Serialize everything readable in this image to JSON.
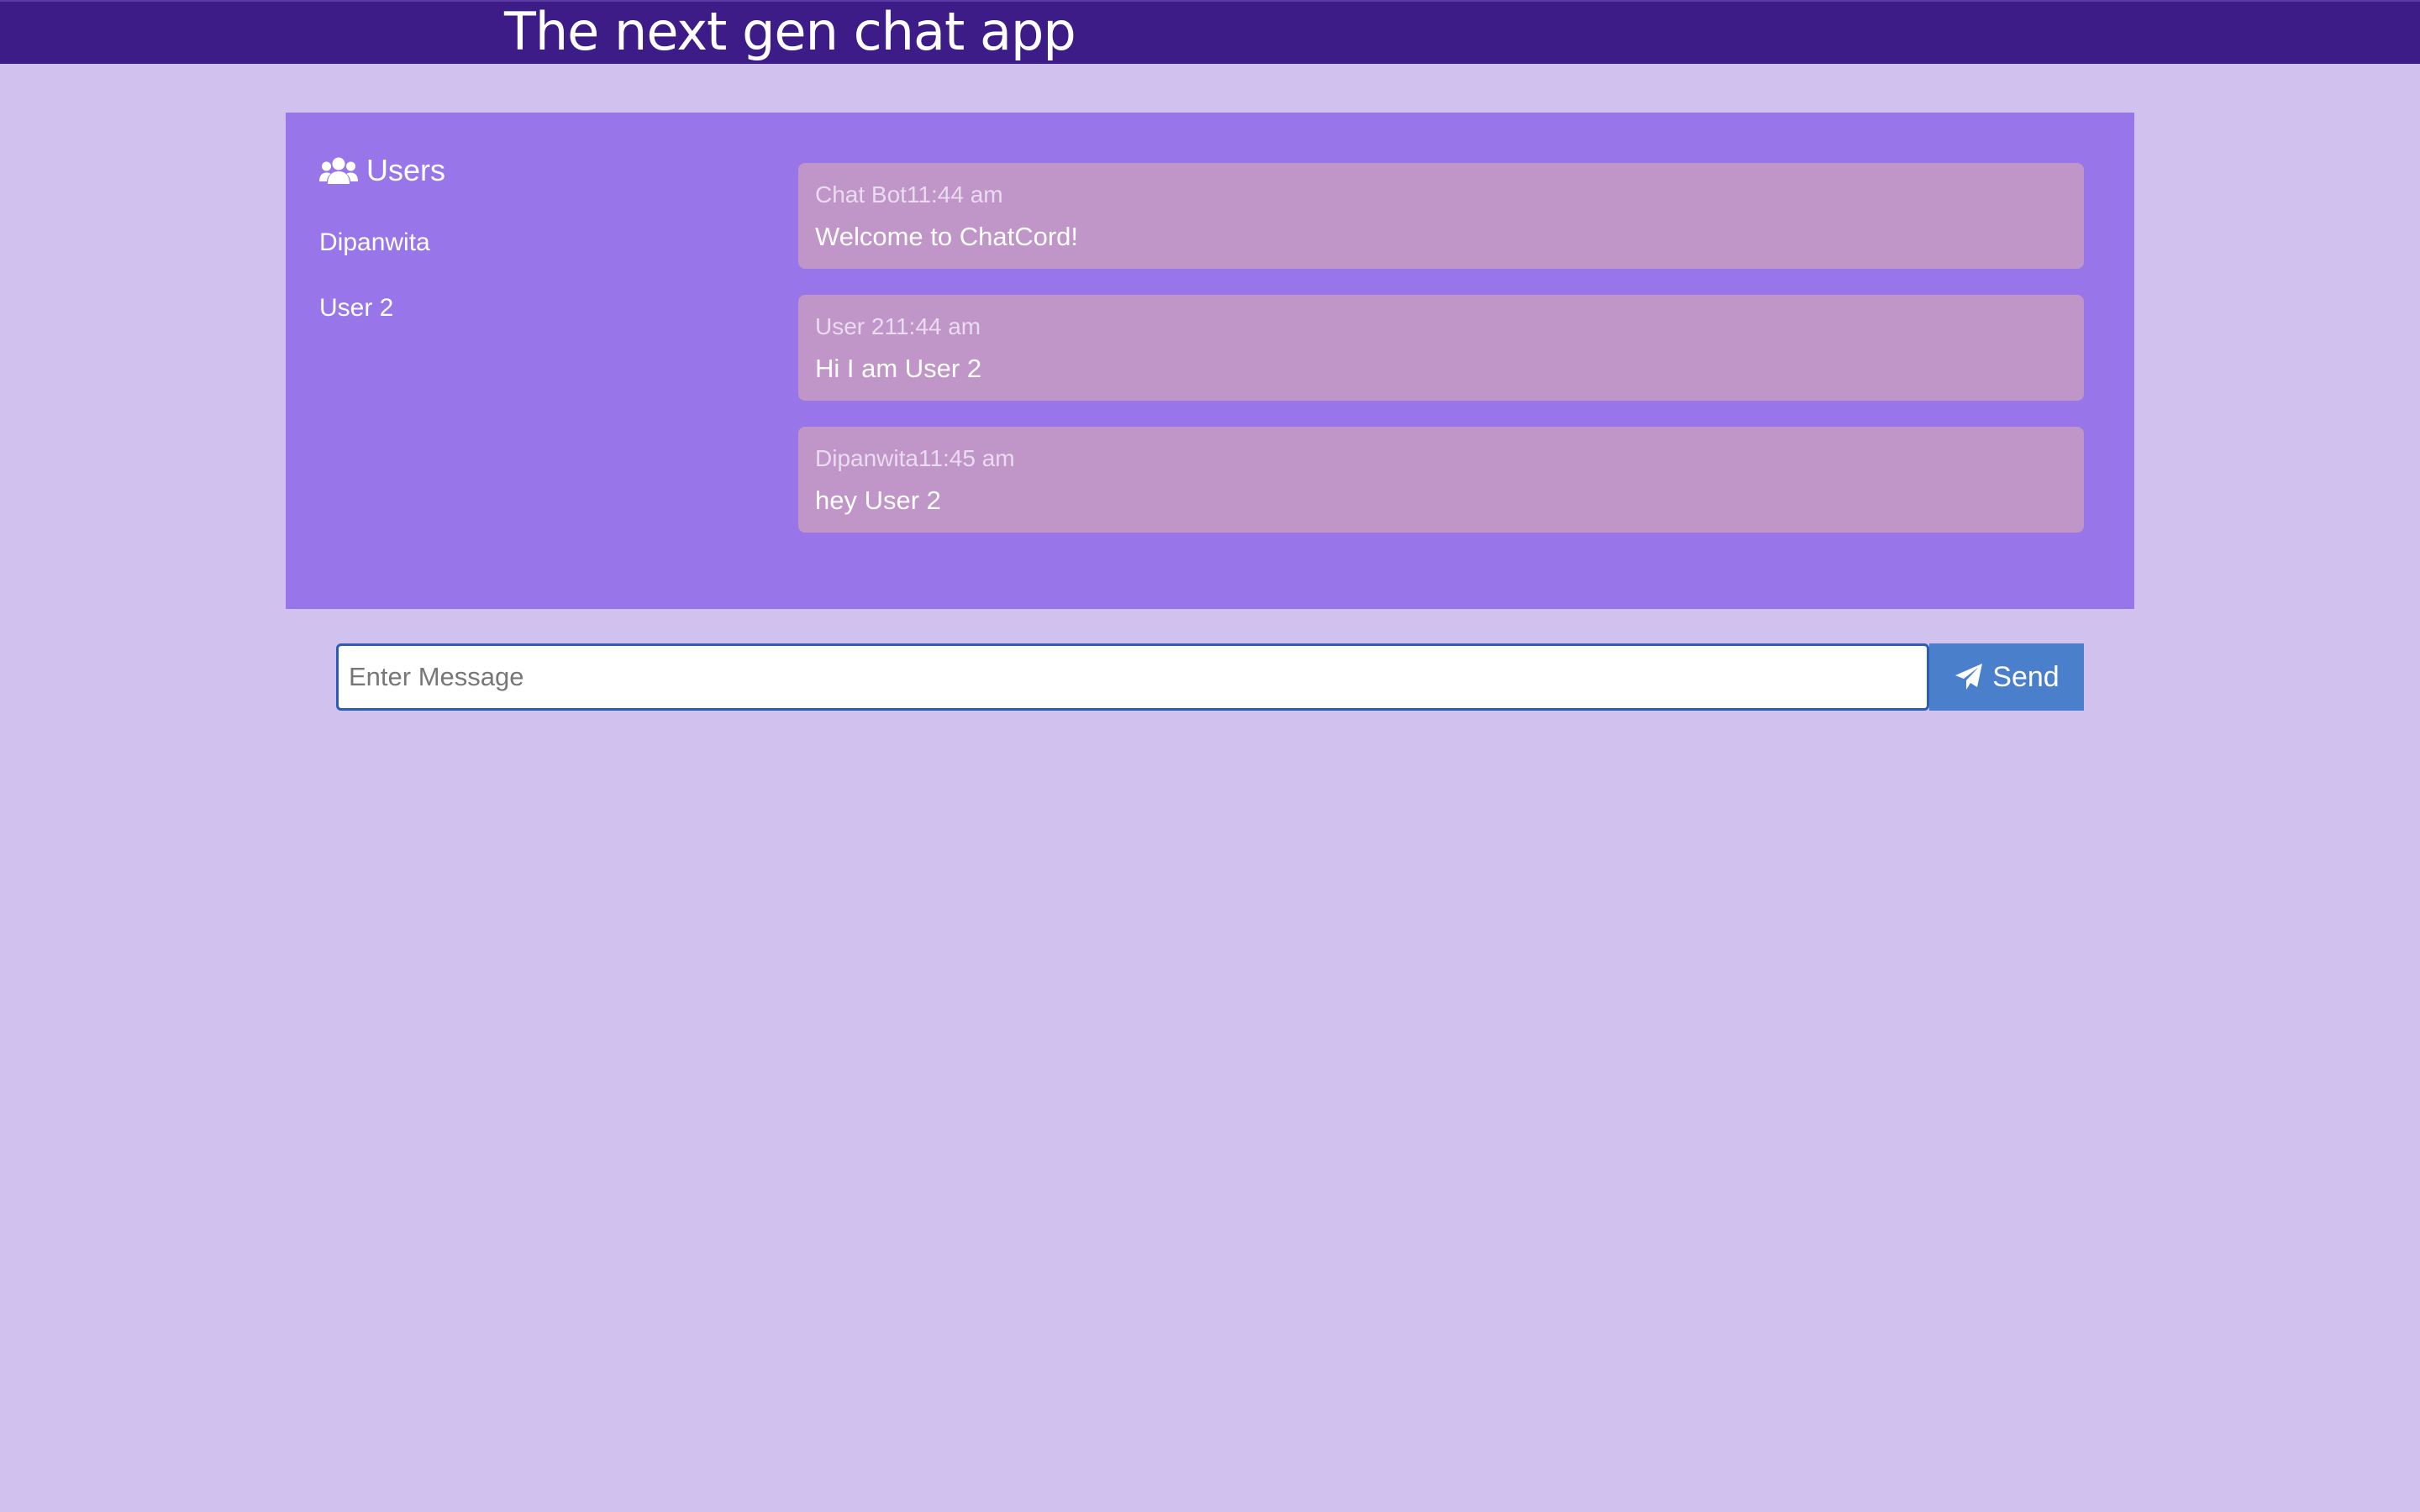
{
  "header": {
    "title": "The next gen chat app"
  },
  "sidebar": {
    "heading": "Users",
    "heading_icon": "users-icon",
    "users": [
      {
        "name": "Dipanwita"
      },
      {
        "name": "User 2"
      }
    ]
  },
  "messages": [
    {
      "author": "Chat Bot",
      "time": "11:44 am",
      "text": "Welcome to ChatCord!"
    },
    {
      "author": "User 2",
      "time": "11:44 am",
      "text": "Hi I am User 2"
    },
    {
      "author": "Dipanwita",
      "time": "11:45 am",
      "text": "hey User 2"
    }
  ],
  "compose": {
    "placeholder": "Enter Message",
    "value": "",
    "send_label": "Send",
    "send_icon": "paper-plane-icon"
  },
  "colors": {
    "topbar": "#3e1c87",
    "background": "#d1c1ee",
    "panel": "#9875e8",
    "message_bubble": "#c095c7",
    "send_button": "#4a7fcc",
    "input_border": "#2a5db8"
  }
}
